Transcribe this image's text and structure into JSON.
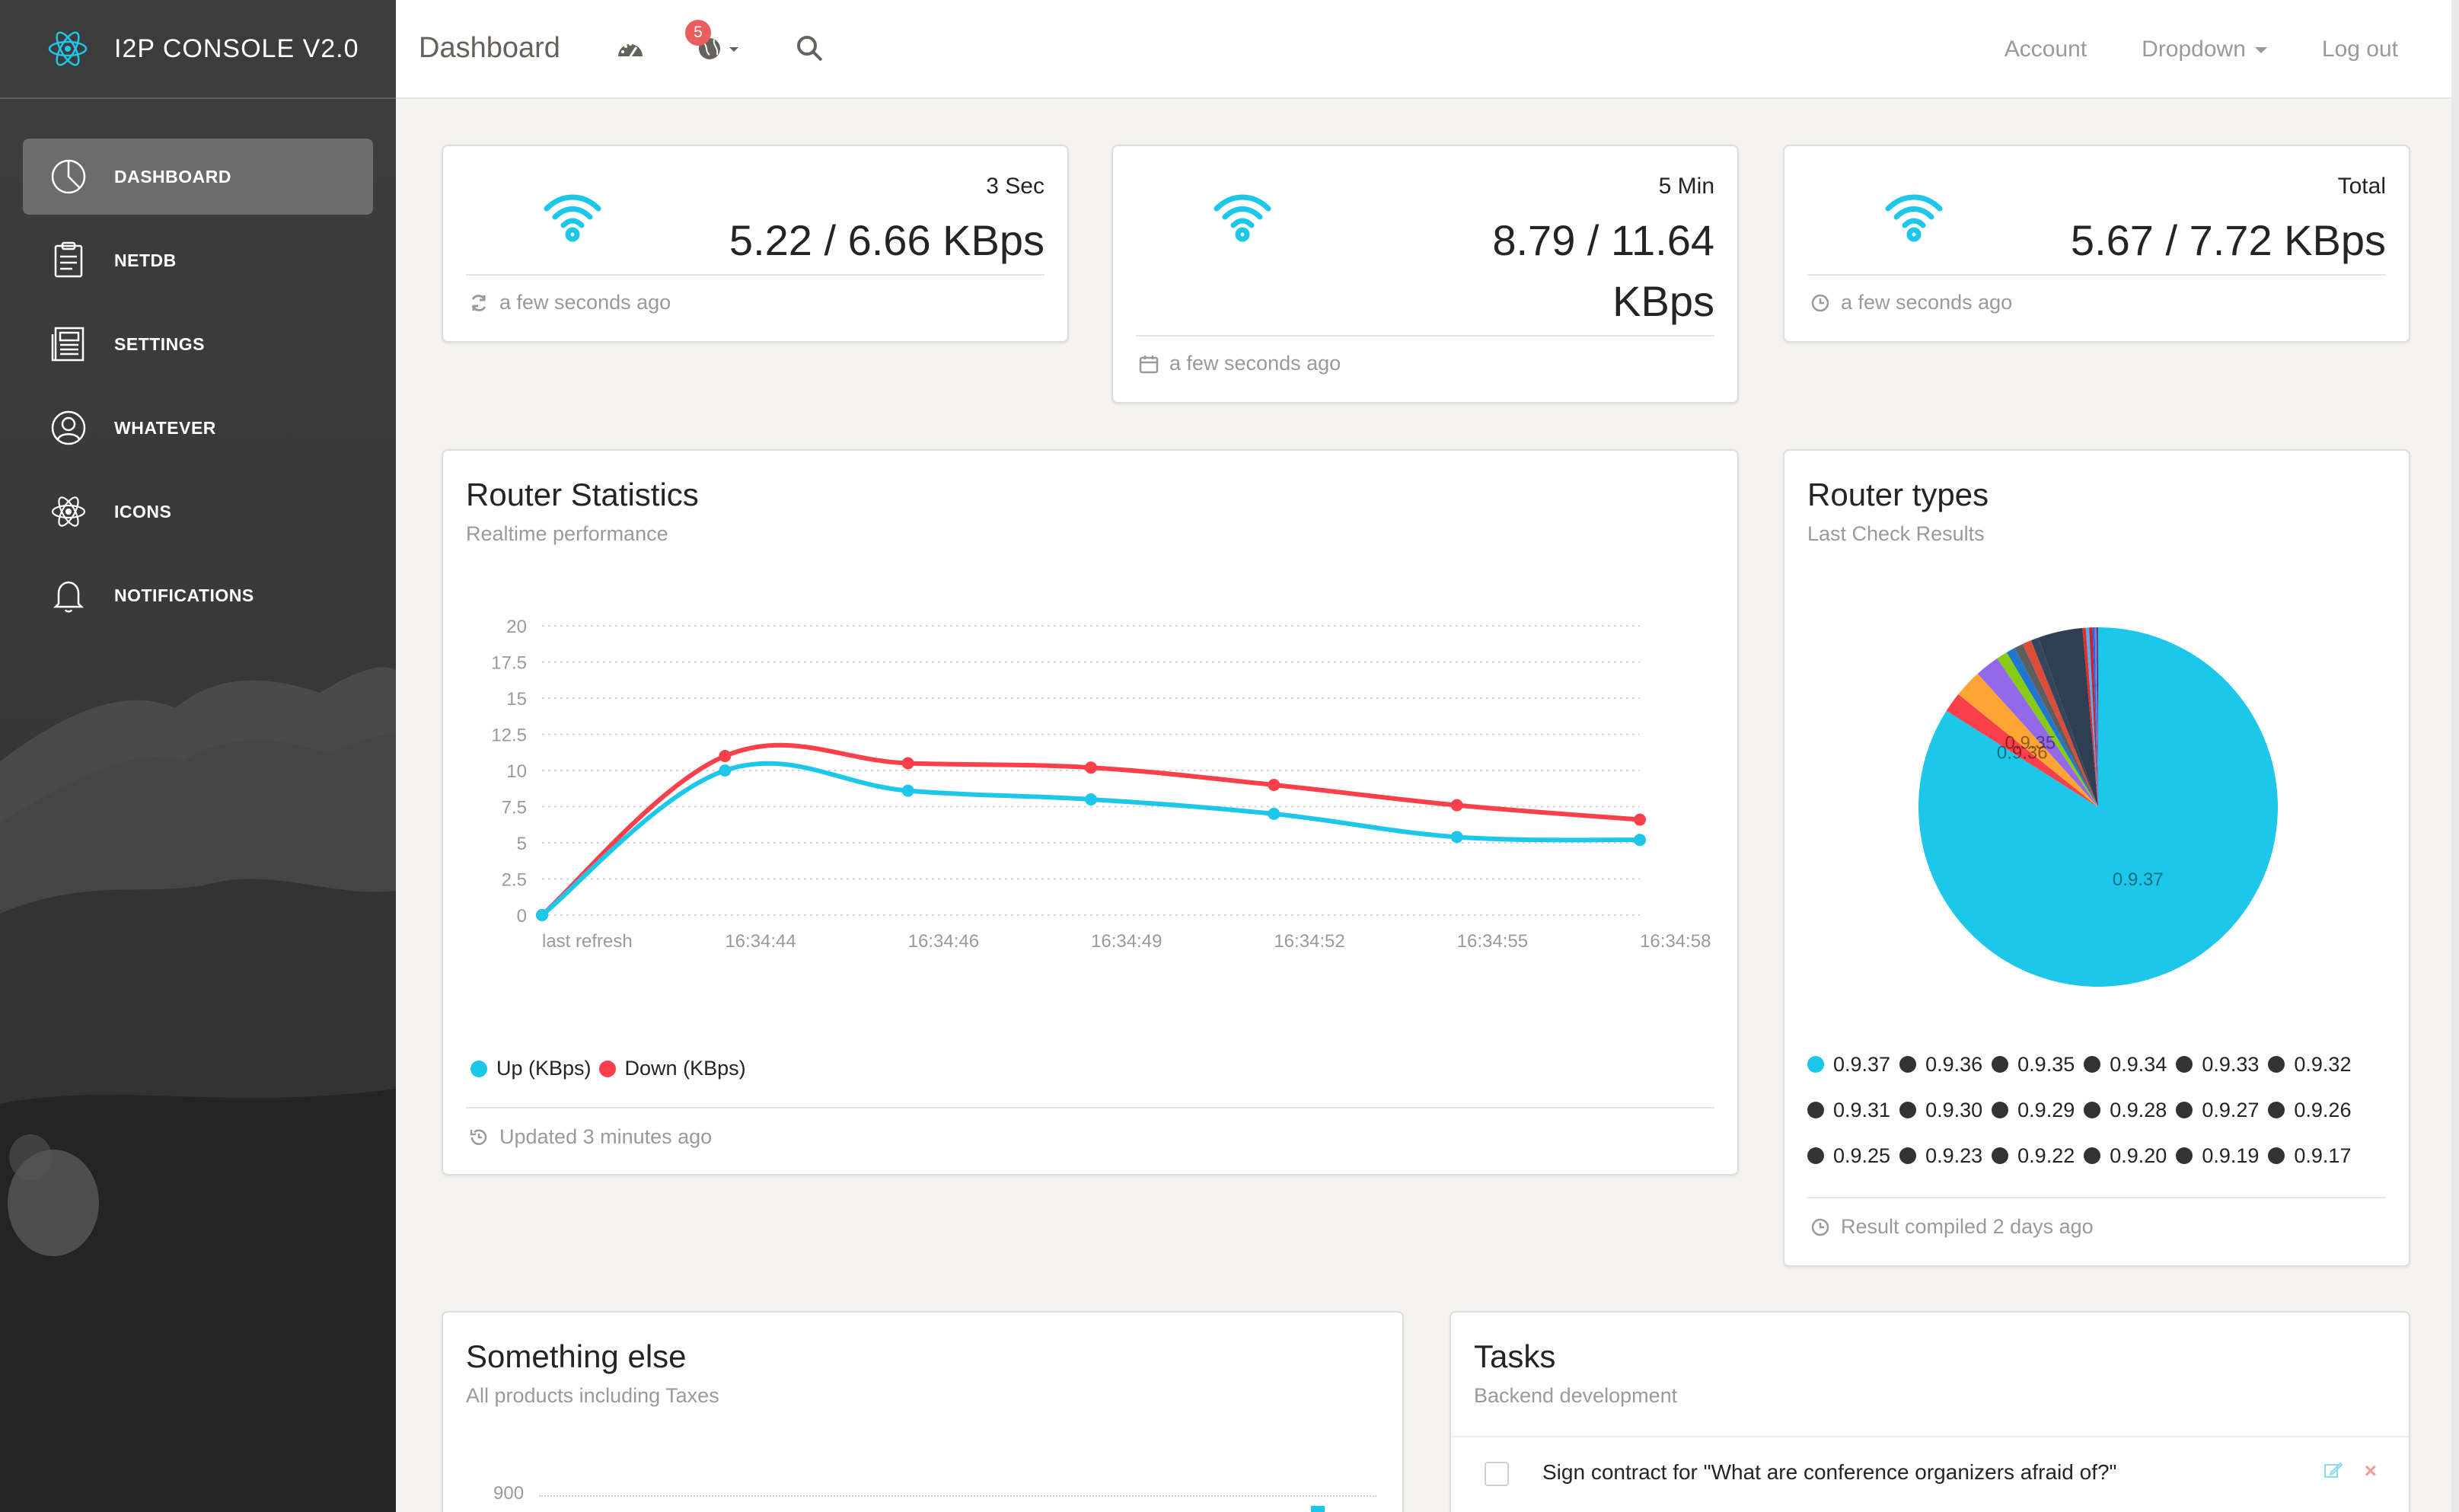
{
  "app": {
    "title": "I2P CONSOLE V2.0"
  },
  "sidebar": {
    "items": [
      {
        "label": "DASHBOARD",
        "icon": "pie-chart-icon",
        "active": true
      },
      {
        "label": "NETDB",
        "icon": "clipboard-icon"
      },
      {
        "label": "SETTINGS",
        "icon": "news-icon"
      },
      {
        "label": "WHATEVER",
        "icon": "user-icon"
      },
      {
        "label": "ICONS",
        "icon": "atom-icon"
      },
      {
        "label": "NOTIFICATIONS",
        "icon": "bell-icon"
      }
    ]
  },
  "navbar": {
    "page_title": "Dashboard",
    "notification_count": "5",
    "links": {
      "account": "Account",
      "dropdown": "Dropdown",
      "logout": "Log out"
    }
  },
  "stats": [
    {
      "label": "3 Sec",
      "value": "5.22 / 6.66 KBps",
      "footer": "a few seconds ago",
      "footer_icon": "refresh-icon"
    },
    {
      "label": "5 Min",
      "value": "8.79 / 11.64 KBps",
      "footer": "a few seconds ago",
      "footer_icon": "calendar-icon"
    },
    {
      "label": "Total",
      "value": "5.67 / 7.72 KBps",
      "footer": "a few seconds ago",
      "footer_icon": "clock-icon"
    }
  ],
  "router_stats": {
    "title": "Router Statistics",
    "subtitle": "Realtime performance",
    "footer": "Updated 3 minutes ago",
    "legend_up": "Up (KBps)",
    "legend_down": "Down (KBps)"
  },
  "router_types": {
    "title": "Router types",
    "subtitle": "Last Check Results",
    "footer": "Result compiled 2 days ago"
  },
  "something_else": {
    "title": "Something else",
    "subtitle": "All products including Taxes",
    "tick": "900"
  },
  "tasks": {
    "title": "Tasks",
    "subtitle": "Backend development",
    "items": [
      {
        "text": "Sign contract for \"What are conference organizers afraid of?\""
      }
    ]
  },
  "colors": {
    "accent": "#1dc7ea",
    "down": "#fb404b",
    "dark": "#333333"
  },
  "chart_data": [
    {
      "type": "line",
      "x": [
        "last refresh",
        "16:34:44",
        "16:34:46",
        "16:34:49",
        "16:34:52",
        "16:34:55",
        "16:34:58"
      ],
      "series": [
        {
          "name": "Up (KBps)",
          "color": "#1dc7ea",
          "values": [
            0,
            10,
            8.6,
            8.0,
            7.0,
            5.4,
            5.2
          ]
        },
        {
          "name": "Down (KBps)",
          "color": "#fb404b",
          "values": [
            0,
            11,
            10.5,
            10.2,
            9.0,
            7.6,
            6.6
          ]
        }
      ],
      "yticks": [
        "0",
        "2.5",
        "5",
        "7.5",
        "10",
        "12.5",
        "15",
        "17.5",
        "20"
      ],
      "ylim": [
        0,
        20
      ]
    },
    {
      "type": "pie",
      "labels": [
        "0.9.37",
        "0.9.36",
        "0.9.35",
        "0.9.34",
        "0.9.33",
        "0.9.32",
        "0.9.31",
        "0.9.30",
        "0.9.29",
        "0.9.28",
        "0.9.27",
        "0.9.26",
        "0.9.25",
        "0.9.23",
        "0.9.22",
        "0.9.20",
        "0.9.19",
        "0.9.17"
      ],
      "values": [
        84,
        1.8,
        2.5,
        2.2,
        1.0,
        0.8,
        0.8,
        0.8,
        0.7,
        4.0,
        0.3,
        0.3,
        0.3,
        0.2,
        0.1,
        0.1,
        0.05,
        0.05
      ],
      "colors": [
        "#1dc7ea",
        "#fb404b",
        "#ffa534",
        "#9368e9",
        "#87cb16",
        "#1f77d0",
        "#5e5e5e",
        "#dd4b39",
        "#35465c",
        "#2f3e52",
        "#e52d27",
        "#55acee",
        "#cc2127",
        "#1769ff",
        "#6188e2",
        "#a748ca",
        "#111111",
        "#444444"
      ],
      "visible_slice_labels": [
        "0.9.37",
        "0.9.36",
        "0.9.35"
      ]
    }
  ]
}
